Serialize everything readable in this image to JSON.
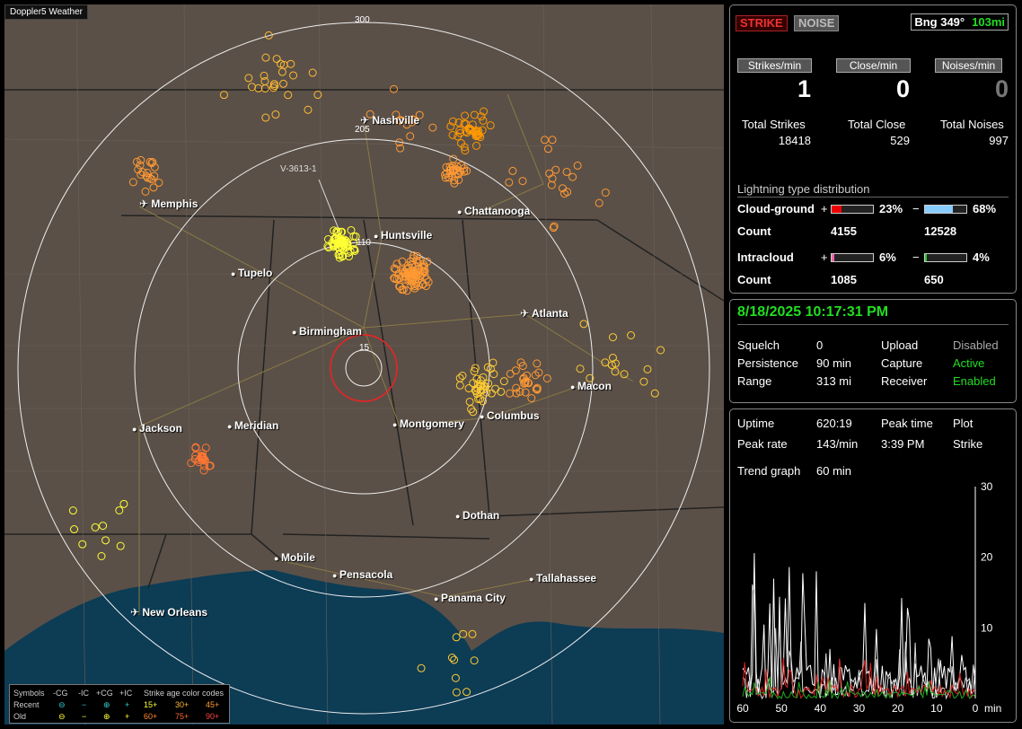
{
  "app": {
    "title": "Doppler5 Weather"
  },
  "map": {
    "ring_labels": [
      "300",
      "205",
      "110",
      "15"
    ],
    "station_label": "V-3613-1",
    "cities": [
      {
        "name": "Nashville",
        "airport": true
      },
      {
        "name": "Memphis",
        "airport": true
      },
      {
        "name": "Chattanooga",
        "airport": false
      },
      {
        "name": "Huntsville",
        "airport": false
      },
      {
        "name": "Tupelo",
        "airport": false
      },
      {
        "name": "Atlanta",
        "airport": true
      },
      {
        "name": "Birmingham",
        "airport": false
      },
      {
        "name": "Macon",
        "airport": false
      },
      {
        "name": "Jackson",
        "airport": false
      },
      {
        "name": "Meridian",
        "airport": false
      },
      {
        "name": "Montgomery",
        "airport": false
      },
      {
        "name": "Columbus",
        "airport": false
      },
      {
        "name": "Dothan",
        "airport": false
      },
      {
        "name": "Mobile",
        "airport": false
      },
      {
        "name": "Pensacola",
        "airport": false
      },
      {
        "name": "Tallahassee",
        "airport": false
      },
      {
        "name": "Panama City",
        "airport": false
      },
      {
        "name": "New Orleans",
        "airport": true
      }
    ]
  },
  "legend": {
    "symbols_label": "Symbols",
    "headers": [
      "-CG",
      "-IC",
      "+CG",
      "+IC"
    ],
    "age_label": "Strike age color codes",
    "recent_label": "Recent",
    "old_label": "Old",
    "recent_ages": [
      "15+",
      "30+",
      "45+"
    ],
    "old_ages": [
      "60+",
      "75+",
      "90+"
    ]
  },
  "status": {
    "strike_btn": "STRIKE",
    "noise_btn": "NOISE",
    "bearing_label": "Bng 349°",
    "bearing_value": "103mi"
  },
  "rates": {
    "strikes_header": "Strikes/min",
    "close_header": "Close/min",
    "noises_header": "Noises/min",
    "strikes_value": "1",
    "close_value": "0",
    "noises_value": "0",
    "total_strikes_label": "Total Strikes",
    "total_close_label": "Total Close",
    "total_noises_label": "Total Noises",
    "total_strikes": "18418",
    "total_close": "529",
    "total_noises": "997"
  },
  "distribution": {
    "title": "Lightning type distribution",
    "cg_label": "Cloud-ground",
    "ic_label": "Intracloud",
    "count_label": "Count",
    "plus": "+",
    "minus": "−",
    "cg_pos_pct": "23%",
    "cg_neg_pct": "68%",
    "ic_pos_pct": "6%",
    "ic_neg_pct": "4%",
    "cg_pos_count": "4155",
    "cg_neg_count": "12528",
    "ic_pos_count": "1085",
    "ic_neg_count": "650",
    "cg_pos_level": 0.23,
    "cg_neg_level": 0.68,
    "ic_pos_level": 0.06,
    "ic_neg_level": 0.04
  },
  "settings": {
    "datetime": "8/18/2025 10:17:31 PM",
    "squelch_label": "Squelch",
    "squelch": "0",
    "persistence_label": "Persistence",
    "persistence": "90 min",
    "range_label": "Range",
    "range": "313 mi",
    "upload_label": "Upload",
    "upload": "Disabled",
    "capture_label": "Capture",
    "capture": "Active",
    "receiver_label": "Receiver",
    "receiver": "Enabled"
  },
  "trend": {
    "uptime_label": "Uptime",
    "uptime": "620:19",
    "peak_time_label": "Peak time",
    "peak_time": "3:39 PM",
    "plot_label": "Plot",
    "plot": "Strike",
    "peak_rate_label": "Peak rate",
    "peak_rate": "143/min",
    "trend_label": "Trend graph",
    "trend": "60 min",
    "y_ticks": [
      "30",
      "20",
      "10"
    ],
    "x_ticks": [
      "60",
      "50",
      "40",
      "30",
      "20",
      "10",
      "0"
    ],
    "x_unit": "min"
  },
  "colors": {
    "strike_red": "#e33",
    "status_green": "#2d2",
    "cg_pos_fill": "#e00",
    "cg_neg_fill": "#8cf",
    "ic_pos_fill": "#e6a",
    "ic_neg_fill": "#2c2"
  }
}
